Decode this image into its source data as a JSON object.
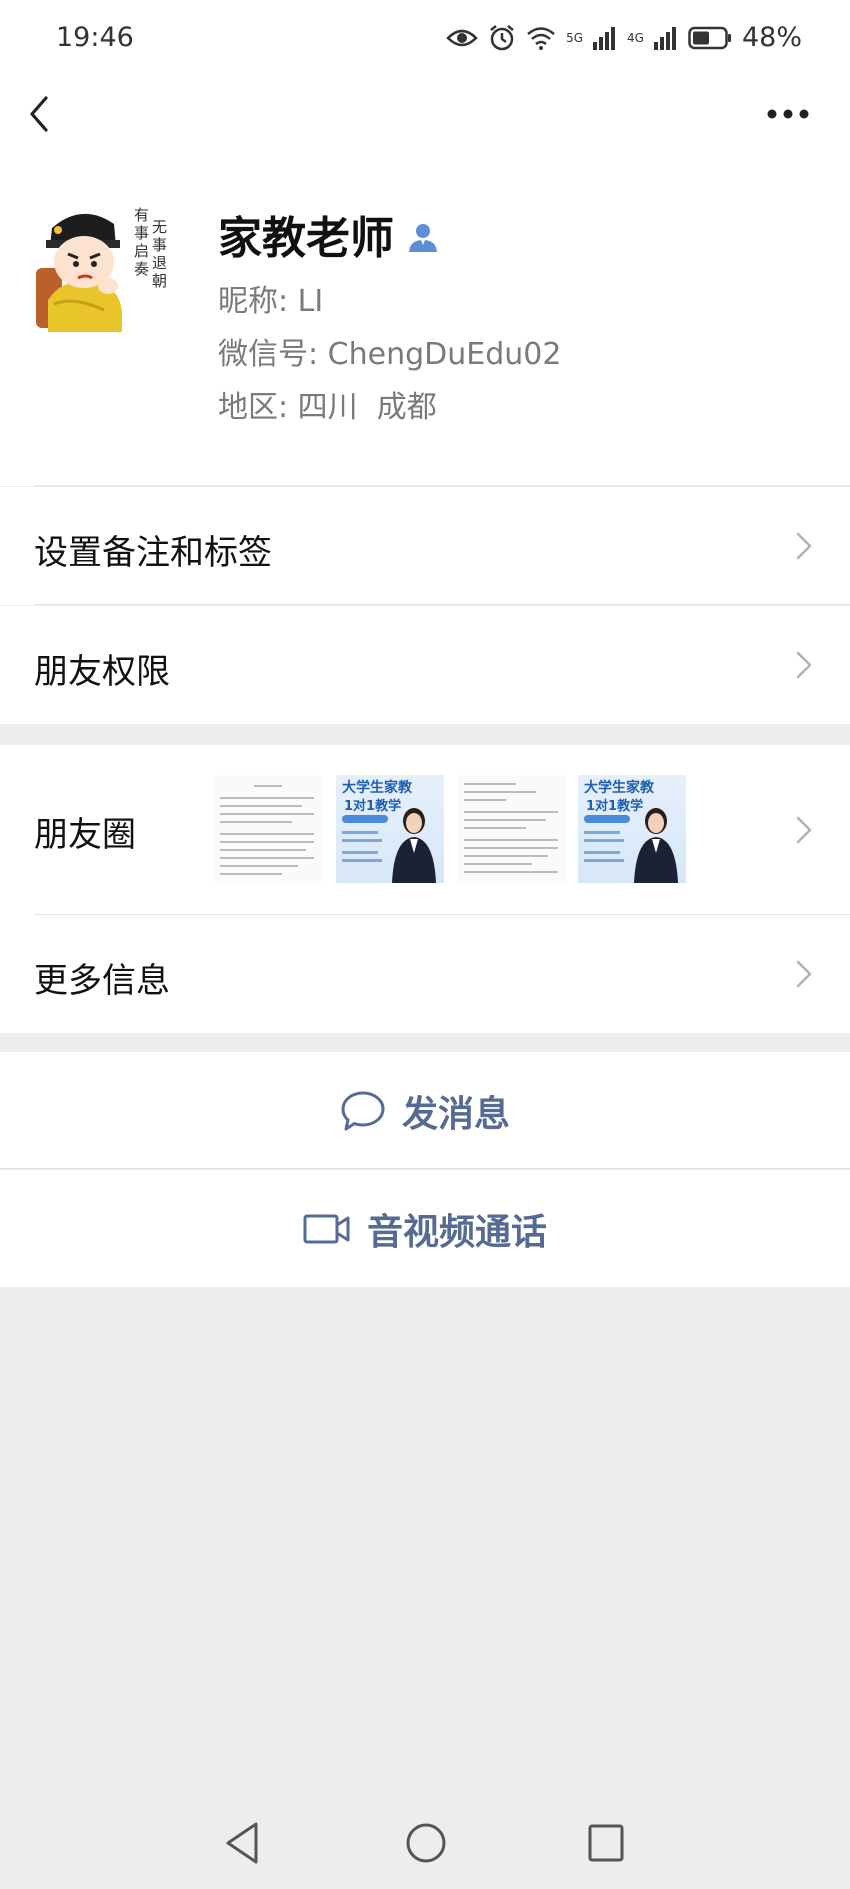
{
  "status": {
    "time": "19:46",
    "net1": "5G",
    "net2": "4G",
    "battery": "48%"
  },
  "profile": {
    "name": "家教老师",
    "nickname_label": "昵称:",
    "nickname_value": "LI",
    "wechat_label": "微信号:",
    "wechat_value": "ChengDuEdu02",
    "region_label": "地区:",
    "region_value": "四川  成都",
    "avatar_text_1": "有事启奏",
    "avatar_text_2": "无事退朝"
  },
  "menu": {
    "remark": "设置备注和标签",
    "permissions": "朋友权限",
    "moments": "朋友圈",
    "more_info": "更多信息"
  },
  "moments_thumbs": [
    {
      "type": "document"
    },
    {
      "type": "poster",
      "headline": "大学生家教",
      "subline": "1对1教学"
    },
    {
      "type": "document"
    },
    {
      "type": "poster",
      "headline": "大学生家教",
      "subline": "1对1教学"
    }
  ],
  "actions": {
    "message": "发消息",
    "call": "音视频通话"
  },
  "colors": {
    "accent": "#566b94",
    "background": "#ededed",
    "verify": "#5b8fd9"
  },
  "icons": [
    "back-icon",
    "more-icon",
    "verify-user-icon",
    "chevron-right-icon",
    "chat-bubble-icon",
    "video-call-icon",
    "nav-back-icon",
    "nav-home-icon",
    "nav-recent-icon"
  ]
}
